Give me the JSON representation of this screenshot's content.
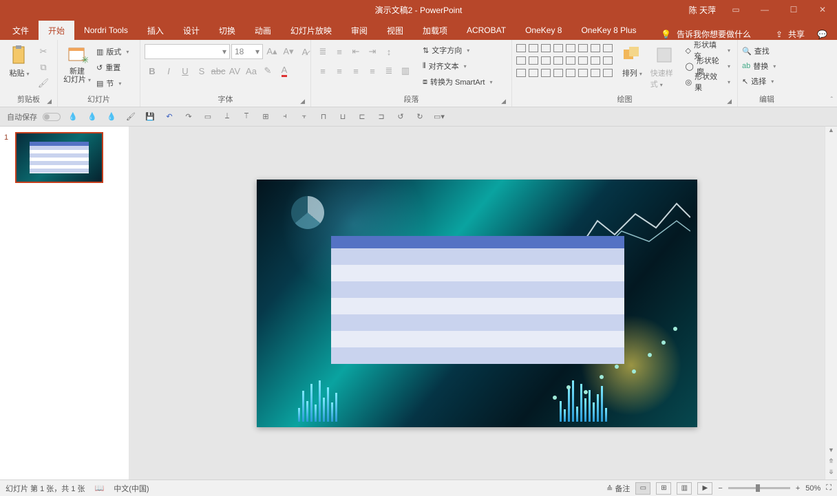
{
  "title": {
    "doc": "演示文稿2",
    "sep": " - ",
    "app": "PowerPoint"
  },
  "user": "陈 天萍",
  "tabs": {
    "file": "文件",
    "home": "开始",
    "nordri": "Nordri Tools",
    "insert": "插入",
    "design": "设计",
    "transition": "切换",
    "animation": "动画",
    "slideshow": "幻灯片放映",
    "review": "审阅",
    "view": "视图",
    "addin": "加载项",
    "acrobat": "ACROBAT",
    "onekey8": "OneKey 8",
    "onekey8plus": "OneKey 8 Plus"
  },
  "tellme": "告诉我你想要做什么",
  "share": "共享",
  "ribbon": {
    "clipboard": {
      "paste": "粘贴",
      "label": "剪贴板"
    },
    "slides": {
      "new": "新建\n幻灯片",
      "layout": "版式",
      "reset": "重置",
      "section": "节",
      "label": "幻灯片"
    },
    "font": {
      "size": "18",
      "label": "字体"
    },
    "paragraph": {
      "textdir": "文字方向",
      "align": "对齐文本",
      "smartart": "转换为 SmartArt",
      "label": "段落"
    },
    "drawing": {
      "arrange": "排列",
      "quickstyle": "快速样式",
      "fill": "形状填充",
      "outline": "形状轮廓",
      "effect": "形状效果",
      "label": "绘图"
    },
    "editing": {
      "find": "查找",
      "replace": "替换",
      "select": "选择",
      "label": "编辑"
    }
  },
  "qat": {
    "autosave": "自动保存"
  },
  "slidepanel": {
    "num1": "1"
  },
  "status": {
    "slideinfo": "幻灯片 第 1 张，共 1 张",
    "lang": "中文(中国)",
    "notes": "备注",
    "zoom": "50%"
  }
}
